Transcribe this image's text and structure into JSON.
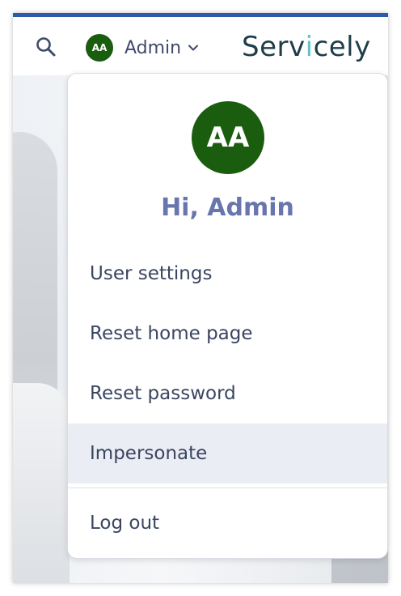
{
  "header": {
    "user_initials": "AA",
    "user_name": "Admin",
    "logo": {
      "part1": "Serv",
      "accent": "i",
      "part2": "cely",
      "accent_color": "#5fc2c9"
    },
    "stripe_color": "#2a5caa"
  },
  "user_dropdown": {
    "avatar_initials": "AA",
    "avatar_color": "#1a5d0f",
    "greeting": "Hi, Admin",
    "items": [
      {
        "label": "User settings"
      },
      {
        "label": "Reset home page"
      },
      {
        "label": "Reset password"
      },
      {
        "label": "Impersonate",
        "highlighted": true
      }
    ],
    "logout_label": "Log out"
  }
}
